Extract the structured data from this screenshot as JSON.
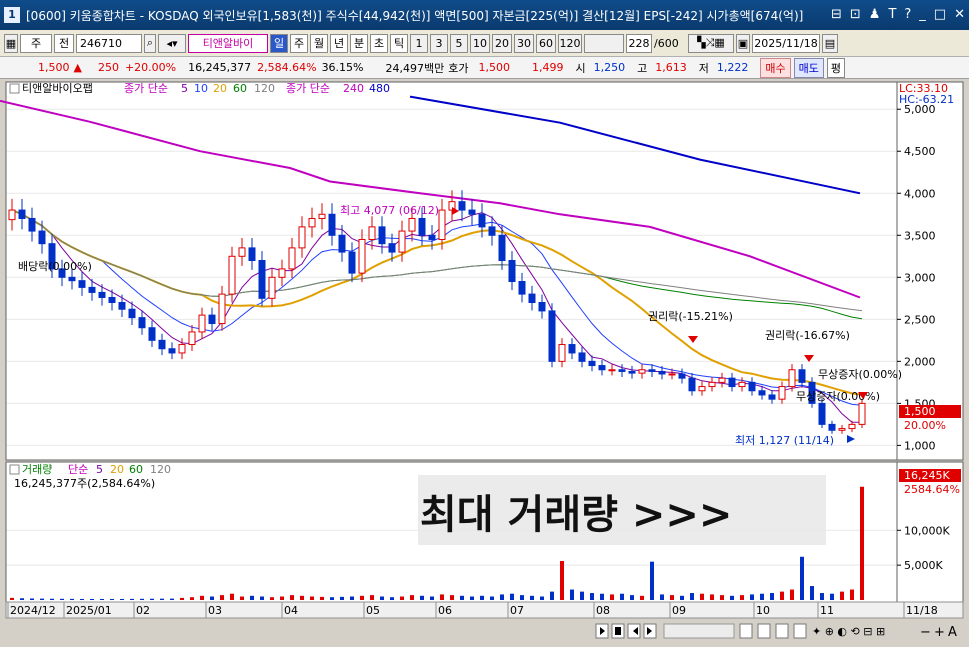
{
  "window": {
    "number": "1",
    "title": "[0600] 키움종합차트 - KOSDAQ 외국인보유[1,583(천)] 주식수[44,942(천)] 액면[500] 자본금[225(억)] 결산[12월] EPS[-242] 시가총액[674(억)]",
    "controls": [
      "⊟",
      "⊡",
      "♟",
      "T",
      "?",
      "_",
      "□",
      "✕"
    ]
  },
  "toolbar": {
    "period_unit": "주",
    "period_prev": "전",
    "code": "246710",
    "company": "티앤알바이",
    "period_tabs": [
      "일",
      "주",
      "월",
      "년",
      "분",
      "초",
      "틱"
    ],
    "active_tab": "일",
    "intervals": [
      "1",
      "3",
      "5",
      "10",
      "20",
      "30",
      "60",
      "120"
    ],
    "count": "228",
    "total": "/600",
    "date": "2025/11/18"
  },
  "quote": {
    "price": "1,500",
    "up_mark": "▲",
    "change": "250",
    "change_pct": "+20.00%",
    "volume": "16,245,377",
    "volume_pct": "2,584.64%",
    "turnover": "36.15%",
    "amount": "24,497백만",
    "bid_label": "호가",
    "ask": "1,500",
    "bid": "1,499",
    "open_label": "시",
    "open": "1,250",
    "high_label": "고",
    "high": "1,613",
    "low_label": "저",
    "low": "1,222",
    "buy": "매수",
    "sell": "매도",
    "avg": "평"
  },
  "price_panel": {
    "legend_name": "티앤알바이오팹",
    "legend_ma": "종가 단순",
    "ma_periods": [
      "5",
      "10",
      "20",
      "60",
      "120"
    ],
    "legend_ma2": "종가 단순",
    "ma2_periods": [
      "240",
      "480"
    ],
    "lc": "LC:33.10",
    "hc": "HC:-63.21",
    "annotations": {
      "high": "최고 4,077 (06/12)",
      "dividend": "배당락(0.00%)",
      "rights1": "권리락(-15.21%)",
      "rights2": "권리락(-16.67%)",
      "bonus1": "무상증자(0.00%)",
      "bonus2": "무상증자(0.00%)",
      "low": "최저 1,127 (11/14)"
    },
    "price_tag": "1,500",
    "pct_tag": "20.00%"
  },
  "volume_panel": {
    "legend_name": "거래량",
    "legend_ma": "단순",
    "ma_periods": [
      "5",
      "20",
      "60",
      "120"
    ],
    "current": "16,245,377주(2,584.64%)",
    "overlay": "최대 거래량 >>>",
    "vol_tag": "16,245K",
    "vol_pct_tag": "2584.64%"
  },
  "x_axis": [
    "2024/12",
    "2025/01",
    "02",
    "03",
    "04",
    "05",
    "06",
    "07",
    "08",
    "09",
    "10",
    "11",
    "11/18"
  ],
  "colors": {
    "up": "#e00000",
    "down": "#0030c8",
    "ma5": "#8000a0",
    "ma10": "#2040ff",
    "ma20": "#e0a000",
    "ma60": "#008000",
    "ma120": "#808080",
    "ma240": "#c000c0",
    "ma480": "#0000c8"
  },
  "chart_data": {
    "type": "candlestick",
    "price_axis": [
      5000,
      4500,
      4000,
      3500,
      3000,
      2500,
      2000,
      1500,
      1000
    ],
    "price_axis_labels": [
      "5,000",
      "4,500",
      "4,000",
      "3,500",
      "3,000",
      "2,500",
      "2,000",
      "1,500",
      "1,000"
    ],
    "volume_axis": [
      10000,
      5000
    ],
    "volume_axis_labels": [
      "10,000K",
      "5,000K"
    ],
    "ylim": [
      850,
      5300
    ],
    "vol_ylim": [
      0,
      17500
    ],
    "closes": [
      3800,
      3700,
      3550,
      3400,
      3100,
      3000,
      2960,
      2880,
      2820,
      2760,
      2700,
      2620,
      2520,
      2400,
      2250,
      2150,
      2100,
      2200,
      2350,
      2550,
      2450,
      2800,
      3250,
      3350,
      3200,
      2750,
      3000,
      3100,
      3350,
      3600,
      3700,
      3750,
      3500,
      3300,
      3050,
      3450,
      3600,
      3400,
      3300,
      3550,
      3700,
      3500,
      3450,
      3800,
      3900,
      3800,
      3750,
      3600,
      3500,
      3200,
      2950,
      2800,
      2700,
      2600,
      2000,
      2200,
      2100,
      2000,
      1950,
      1900,
      1900,
      1880,
      1860,
      1900,
      1880,
      1850,
      1850,
      1800,
      1650,
      1700,
      1750,
      1800,
      1700,
      1750,
      1650,
      1600,
      1550,
      1700,
      1900,
      1750,
      1500,
      1250,
      1180,
      1200,
      1250,
      1500
    ],
    "volumes": [
      300,
      250,
      220,
      200,
      180,
      170,
      160,
      150,
      150,
      150,
      140,
      150,
      160,
      170,
      180,
      190,
      200,
      300,
      400,
      600,
      500,
      700,
      900,
      500,
      600,
      500,
      400,
      500,
      700,
      600,
      500,
      450,
      400,
      450,
      500,
      600,
      700,
      500,
      400,
      500,
      700,
      600,
      500,
      800,
      700,
      600,
      500,
      600,
      500,
      800,
      900,
      700,
      600,
      500,
      1200,
      5600,
      1500,
      1200,
      1000,
      900,
      800,
      900,
      700,
      600,
      5500,
      800,
      700,
      600,
      1000,
      900,
      800,
      700,
      600,
      700,
      800,
      900,
      1000,
      1200,
      1500,
      6200,
      2000,
      1000,
      900,
      1200,
      1500,
      16245
    ],
    "ma240": [
      [
        0,
        5100
      ],
      [
        90,
        4850
      ],
      [
        200,
        4500
      ],
      [
        290,
        4300
      ],
      [
        330,
        4140
      ],
      [
        420,
        4000
      ],
      [
        500,
        3880
      ],
      [
        560,
        3750
      ],
      [
        650,
        3600
      ],
      [
        750,
        3250
      ],
      [
        860,
        2760
      ]
    ],
    "ma480": [
      [
        410,
        5150
      ],
      [
        560,
        4840
      ],
      [
        700,
        4400
      ],
      [
        860,
        4000
      ]
    ]
  }
}
